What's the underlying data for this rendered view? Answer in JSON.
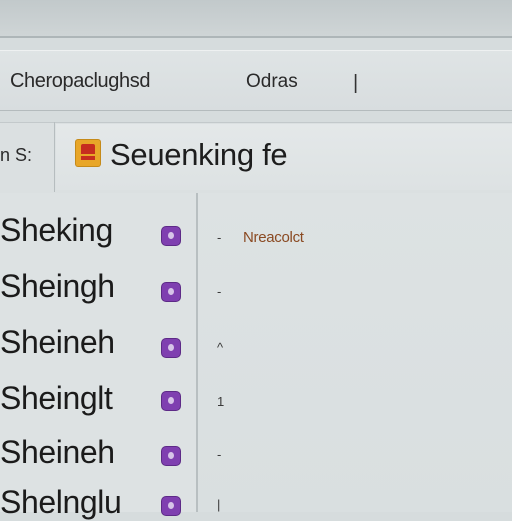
{
  "menubar": {
    "title": "Cheropaclughsd",
    "item": "Odras",
    "separator": "|"
  },
  "search": {
    "label": "n S:",
    "value": "Seuenking fe"
  },
  "list": {
    "rows": [
      {
        "label": "Sheking",
        "mark": "-"
      },
      {
        "label": "Sheingh",
        "mark": "-"
      },
      {
        "label": "Sheineh",
        "mark": "^"
      },
      {
        "label": "Sheinglt",
        "mark": "1"
      },
      {
        "label": "Sheineh",
        "mark": "-"
      },
      {
        "label": "Shelnglu",
        "mark": "|"
      }
    ]
  },
  "detail": {
    "text": "Nreacolct"
  },
  "icons": {
    "search": "search-folder-icon",
    "badge": "purple-status-badge-icon"
  },
  "colors": {
    "badge": "#7f3fb0",
    "search_icon": "#e8a628",
    "detail_text": "#8a4a22"
  }
}
